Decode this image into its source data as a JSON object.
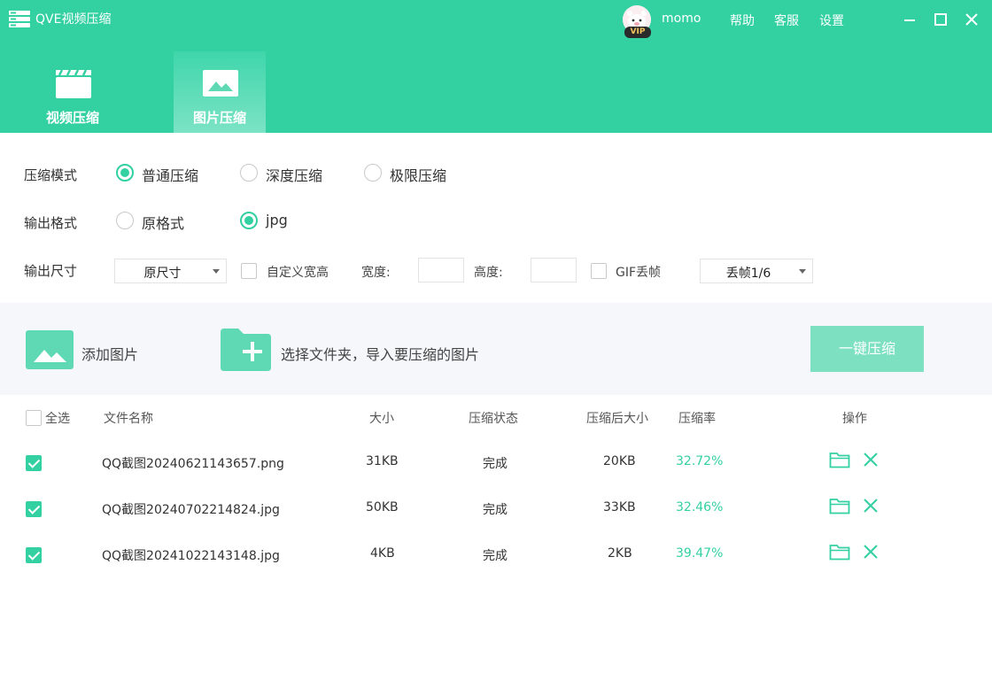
{
  "app": {
    "title": "QVE视频压缩",
    "username": "momo",
    "vip_badge": "VIP"
  },
  "top_links": {
    "help": "帮助",
    "service": "客服",
    "settings": "设置"
  },
  "tabs": [
    {
      "label": "视频压缩",
      "active": false,
      "icon": "clapperboard-icon"
    },
    {
      "label": "图片压缩",
      "active": true,
      "icon": "image-icon"
    }
  ],
  "options": {
    "mode_label": "压缩模式",
    "modes": [
      {
        "label": "普通压缩",
        "selected": true
      },
      {
        "label": "深度压缩",
        "selected": false
      },
      {
        "label": "极限压缩",
        "selected": false
      }
    ],
    "format_label": "输出格式",
    "formats": [
      {
        "label": "原格式",
        "selected": false
      },
      {
        "label": "jpg",
        "selected": true
      }
    ],
    "size_label": "输出尺寸",
    "size_value": "原尺寸",
    "custom_size_label": "自定义宽高",
    "width_label": "宽度:",
    "height_label": "高度:",
    "gif_label": "GIF丢帧",
    "gif_value": "丢帧1/6"
  },
  "actions": {
    "add_images": "添加图片",
    "select_folder": "选择文件夹，导入要压缩的图片",
    "compress_button": "一键压缩"
  },
  "table": {
    "headers": {
      "select_all": "全选",
      "filename": "文件名称",
      "size": "大小",
      "status": "压缩状态",
      "compressed_size": "压缩后大小",
      "rate": "压缩率",
      "actions": "操作"
    },
    "rows": [
      {
        "checked": true,
        "filename": "QQ截图20240621143657.png",
        "size": "31KB",
        "status": "完成",
        "compressed_size": "20KB",
        "rate": "32.72%"
      },
      {
        "checked": true,
        "filename": "QQ截图20240702214824.jpg",
        "size": "50KB",
        "status": "完成",
        "compressed_size": "33KB",
        "rate": "32.46%"
      },
      {
        "checked": true,
        "filename": "QQ截图20241022143148.jpg",
        "size": "4KB",
        "status": "完成",
        "compressed_size": "2KB",
        "rate": "39.47%"
      }
    ]
  },
  "colors": {
    "accent": "#33d0a2",
    "accent_light": "#7de0c1",
    "band_bg": "#f5f7fa"
  }
}
